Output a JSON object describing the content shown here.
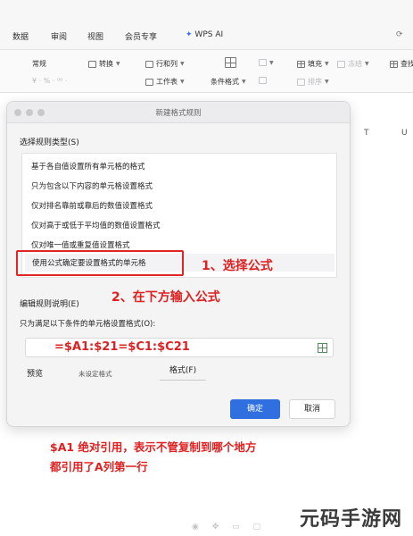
{
  "ribbon": {
    "tabs": [
      "数据",
      "审阅",
      "视图",
      "会员专享",
      "WPS AI"
    ],
    "tools": {
      "number_format": "常规",
      "convert": "转换",
      "rows_cols": "行和列",
      "worksheet": "工作表",
      "conditional_format": "条件格式",
      "fill": "填充",
      "sort": "排序",
      "freeze": "冻结",
      "find": "查找"
    },
    "column_headers": [
      "T",
      "U"
    ]
  },
  "dialog": {
    "title": "新建格式规则",
    "rule_type_heading": "选择规则类型(S)",
    "rule_types": [
      "基于各自值设置所有单元格的格式",
      "只为包含以下内容的单元格设置格式",
      "仅对排名靠前或靠后的数值设置格式",
      "仅对高于或低于平均值的数值设置格式",
      "仅对唯一值或重复值设置格式",
      "使用公式确定要设置格式的单元格"
    ],
    "selected_index": 5,
    "edit_heading": "编辑规则说明(E)",
    "formula_label": "只为满足以下条件的单元格设置格式(O):",
    "formula_value": "=$A1:$21=$C1:$C21",
    "preview_label": "预览",
    "preview_text": "未设定格式",
    "format_button": "格式(F)",
    "ok_button": "确定",
    "cancel_button": "取消"
  },
  "annotations": {
    "step1": "1、选择公式",
    "step2": "2、在下方输入公式",
    "note_line1": "$A1 绝对引用，表示不管复制到哪个地方",
    "note_line2": "都引用了A列第一行"
  },
  "watermark": "元码手游网",
  "colors": {
    "annotation_red": "#e02020",
    "primary_button": "#2f6fe0"
  }
}
